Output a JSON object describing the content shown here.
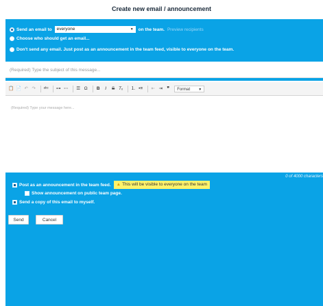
{
  "header": {
    "title": "Create new email / announcement"
  },
  "options": {
    "send_prefix": "Send an email to",
    "recipient_selected": "everyone",
    "send_suffix": "on the team.",
    "preview_link": "Preview recipients",
    "choose_label": "Choose who should get an email...",
    "no_email_label": "Don't send any email. Just post as an announcement in the team feed, visible to everyone on the team."
  },
  "subject": {
    "placeholder": "(Required) Type the subject of this message..."
  },
  "toolbar": {
    "buttons": [
      "paste-icon",
      "paste-text-icon",
      "undo-icon",
      "redo-icon",
      "spellcheck-icon",
      "link-icon",
      "unlink-icon",
      "horizontal-rule-icon",
      "special-char-icon",
      "bold-icon",
      "italic-icon",
      "strike-icon",
      "remove-format-icon",
      "numbered-list-icon",
      "bulleted-list-icon",
      "outdent-icon",
      "indent-icon",
      "blockquote-icon"
    ],
    "format_label": "Format"
  },
  "editor": {
    "placeholder": "(Required) Type your message here..."
  },
  "footer": {
    "counter": "0 of 4000 characters",
    "post_announcement": "Post as an announcement in the team feed.",
    "warning": "This will be visible to everyone on the team",
    "public_page": "Show announcement on public team page.",
    "copy_myself": "Send a copy of this email to myself.",
    "send_label": "Send",
    "cancel_label": "Cancel"
  },
  "colors": {
    "accent": "#0aa3e6",
    "warning": "#fff36a"
  }
}
